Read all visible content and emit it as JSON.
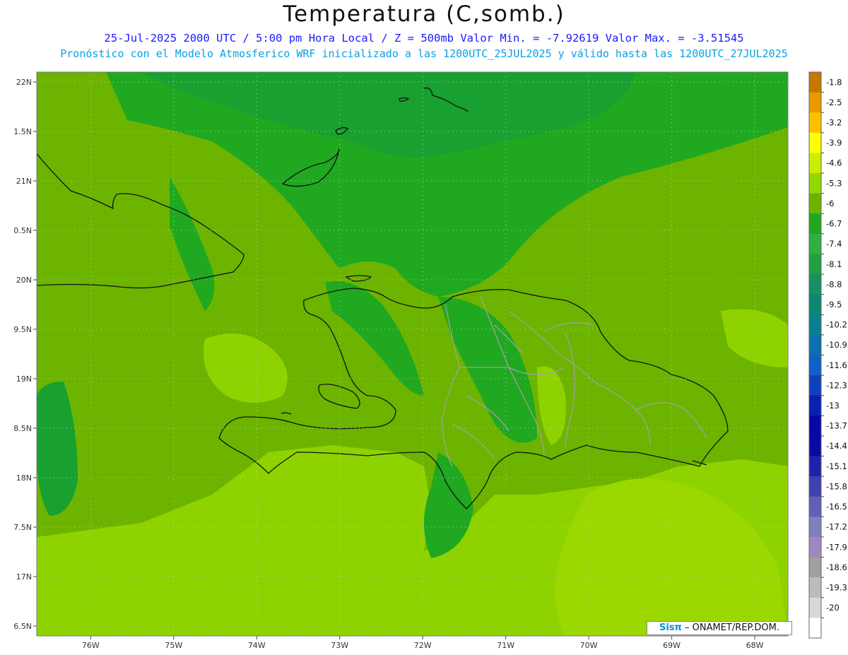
{
  "title": "Temperatura (C,somb.)",
  "subtitle_line1": "25-Jul-2025   2000 UTC / 5:00 pm Hora Local / Z = 500mb  Valor Min. = -7.92619  Valor Max. = -3.51545",
  "subtitle_line2": "Pronóstico con el Modelo Atmosferico WRF inicializado a las 1200UTC_25JUL2025 y válido hasta las  1200UTC_27JUL2025",
  "credit": {
    "brand": "Sisπ",
    "rest": " – ONAMET/REP.DOM."
  },
  "axes": {
    "lat_labels": [
      "22N",
      "1.5N",
      "21N",
      "0.5N",
      "20N",
      "9.5N",
      "19N",
      "8.5N",
      "18N",
      "7.5N",
      "17N",
      "6.5N"
    ],
    "lat_values": [
      22,
      21.5,
      21,
      20.5,
      20,
      19.5,
      19,
      18.5,
      18,
      17.5,
      17,
      16.5
    ],
    "lon_labels": [
      "76W",
      "75W",
      "74W",
      "73W",
      "72W",
      "71W",
      "70W",
      "69W",
      "68W"
    ],
    "lon_values": [
      -76,
      -75,
      -74,
      -73,
      -72,
      -71,
      -70,
      -69,
      -68
    ],
    "lat_range": [
      16.4,
      22.1
    ],
    "lon_range": [
      -76.65,
      -67.6
    ]
  },
  "colorbar": {
    "labels": [
      "-1.8",
      "-2.5",
      "-3.2",
      "-3.9",
      "-4.6",
      "-5.3",
      "-6",
      "-6.7",
      "-7.4",
      "-8.1",
      "-8.8",
      "-9.5",
      "-10.2",
      "-10.9",
      "-11.6",
      "-12.3",
      "-13",
      "-13.7",
      "-14.4",
      "-15.1",
      "-15.8",
      "-16.5",
      "-17.2",
      "-17.9",
      "-18.6",
      "-19.3",
      "-20"
    ],
    "colors": [
      "#c47800",
      "#e89a00",
      "#ffc000",
      "#ffff00",
      "#c8f000",
      "#92d800",
      "#6cb400",
      "#20a820",
      "#30b040",
      "#20a040",
      "#189060",
      "#0c8870",
      "#088090",
      "#0a70b0",
      "#1060c8",
      "#1040c0",
      "#0a20b0",
      "#0808a8",
      "#0a0aa0",
      "#2020a8",
      "#4040b0",
      "#6060b8",
      "#8080c0",
      "#9a8ac0",
      "#a0a0a0",
      "#bcbcbc",
      "#d8d8d8",
      "#ffffff"
    ]
  },
  "map_legend_colors": {
    "light": "#8ed300",
    "mid": "#6cb400",
    "dark": "#20a820",
    "darkest": "#189a30"
  }
}
